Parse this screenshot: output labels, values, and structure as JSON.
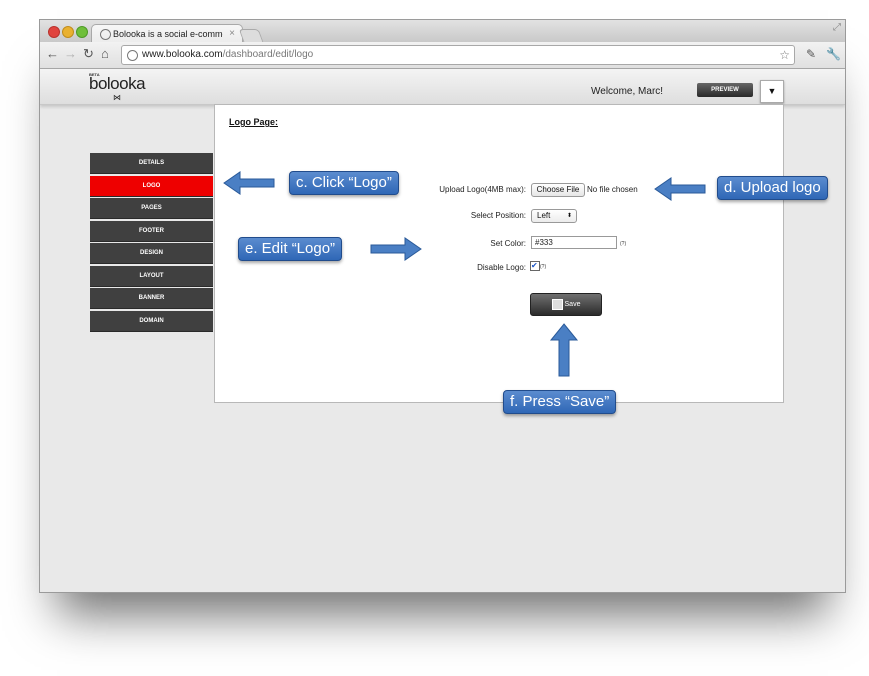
{
  "browser": {
    "tab_title": "Bolooka is a social e-comme",
    "tab_close": "×",
    "url_host": "www.bolooka.com",
    "url_path": "/dashboard/edit/logo"
  },
  "site": {
    "logo_beta": "BETA",
    "logo_text": "bolooka",
    "logo_mark": "⋈",
    "welcome": "Welcome, Marc!",
    "preview_label": "PREVIEW",
    "dropdown_glyph": "▼"
  },
  "sidebar": {
    "items": [
      {
        "label": "DETAILS",
        "active": false
      },
      {
        "label": "LOGO",
        "active": true
      },
      {
        "label": "PAGES",
        "active": false
      },
      {
        "label": "FOOTER",
        "active": false
      },
      {
        "label": "DESIGN",
        "active": false
      },
      {
        "label": "LAYOUT",
        "active": false
      },
      {
        "label": "BANNER",
        "active": false
      },
      {
        "label": "DOMAIN",
        "active": false
      }
    ]
  },
  "form": {
    "page_title": "Logo Page:",
    "upload_label": "Upload Logo(4MB max):",
    "choose_file_label": "Choose File",
    "no_file_text": "No file chosen",
    "position_label": "Select Position:",
    "position_value": "Left",
    "color_label": "Set Color:",
    "color_value": "#333",
    "disable_label": "Disable Logo:",
    "disable_checked": true,
    "help_marker": "(?)",
    "save_label": "Save"
  },
  "callouts": {
    "c": "c. Click “Logo”",
    "d": "d. Upload logo",
    "e": "e. Edit “Logo”",
    "f": "f. Press “Save”"
  },
  "colors": {
    "accent_red": "#ee0000",
    "callout_blue": "#3a72c0",
    "sidebar_dark": "#404040"
  }
}
